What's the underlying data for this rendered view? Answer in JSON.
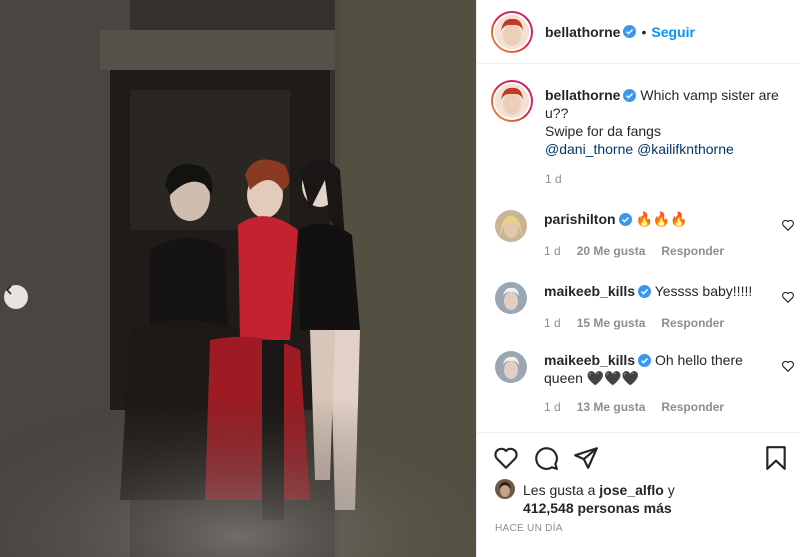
{
  "post": {
    "author": "bellathorne",
    "follow_label": "Seguir",
    "dot": "•"
  },
  "caption": {
    "username": "bellathorne",
    "line1": "Which vamp sister are u??",
    "line2": "Swipe for da fangs",
    "mention1": "@dani_thorne",
    "mention2": "@kailifknthorne",
    "time": "1 d"
  },
  "comments": [
    {
      "username": "parishilton",
      "text": "🔥🔥🔥",
      "time": "1 d",
      "likes": "20 Me gusta",
      "reply": "Responder"
    },
    {
      "username": "maikeeb_kills",
      "text": "Yessss baby!!!!!",
      "time": "1 d",
      "likes": "15 Me gusta",
      "reply": "Responder"
    },
    {
      "username": "maikeeb_kills",
      "text": "Oh hello there queen 🖤🖤🖤",
      "time": "1 d",
      "likes": "13 Me gusta",
      "reply": "Responder"
    }
  ],
  "likes": {
    "prefix": "Les gusta a ",
    "user": "jose_alflo",
    "suffix": " y",
    "count": "412,548 personas más"
  },
  "timestamp": "HACE UN DÍA",
  "colors": {
    "accent": "#0095f6",
    "verified": "#3897f0",
    "muted": "#8e8e8e"
  },
  "icons": [
    "chevron-left-icon",
    "heart-icon",
    "comment-icon",
    "share-icon",
    "bookmark-icon",
    "verified-badge-icon"
  ]
}
